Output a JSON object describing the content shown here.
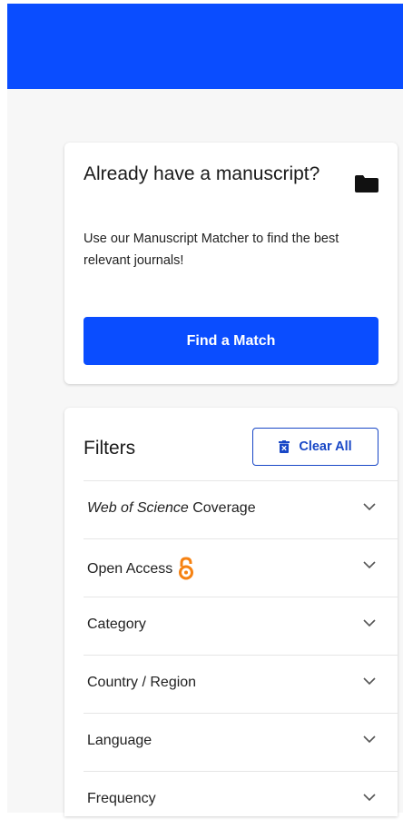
{
  "colors": {
    "brand_blue": "#0a4dff",
    "outline_blue": "#1847c6",
    "open_access_orange": "#f68212"
  },
  "manuscript_card": {
    "title": "Already have a manuscript?",
    "description": "Use our Manuscript Matcher to find the best relevant journals!",
    "button_label": "Find a Match",
    "icon": "folder-icon"
  },
  "filters": {
    "title": "Filters",
    "clear_label": "Clear All",
    "clear_icon": "trash-icon",
    "items": [
      {
        "label_italic": "Web of Science",
        "label": " Coverage"
      },
      {
        "label": "Open Access",
        "icon": "open-access-icon"
      },
      {
        "label": "Category"
      },
      {
        "label": "Country / Region"
      },
      {
        "label": "Language"
      },
      {
        "label": "Frequency"
      }
    ]
  }
}
